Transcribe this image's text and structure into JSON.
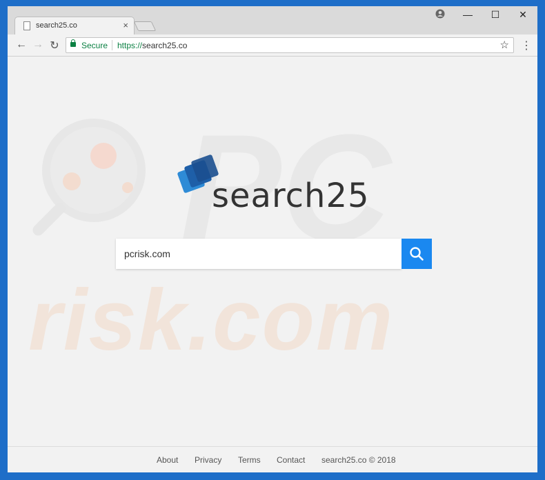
{
  "browser": {
    "tab_title": "search25.co",
    "tab_close": "×",
    "controls": {
      "minimize": "—",
      "maximize": "☐",
      "close": "✕"
    },
    "nav": {
      "back": "←",
      "forward": "→",
      "reload": "↻"
    },
    "address": {
      "secure_label": "Secure",
      "scheme": "https://",
      "host": "search25.co"
    },
    "star": "☆",
    "menu": "⋮"
  },
  "watermark": {
    "pc": "PC",
    "risk": "risk.com"
  },
  "logo": {
    "text": "search25",
    "colors": [
      "#2e8bd6",
      "#1e5fa8",
      "#1b4f8f"
    ]
  },
  "search": {
    "value": "pcrisk.com",
    "button_icon": "search-icon",
    "button_color": "#1a88f0"
  },
  "footer": {
    "links": [
      "About",
      "Privacy",
      "Terms",
      "Contact"
    ],
    "copyright": "search25.co © 2018"
  }
}
